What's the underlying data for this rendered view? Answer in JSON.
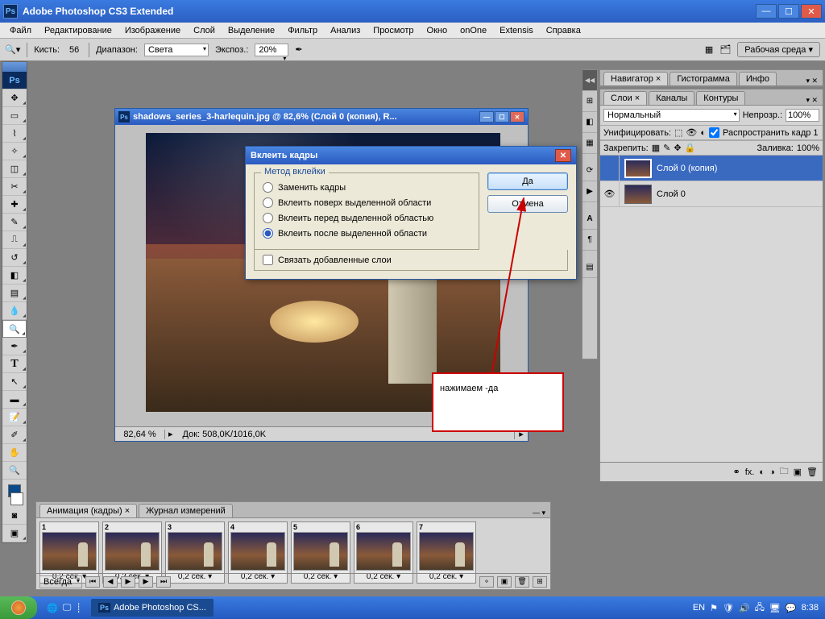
{
  "titlebar": {
    "ps": "Ps",
    "title": "Adobe Photoshop CS3 Extended"
  },
  "menubar": [
    "Файл",
    "Редактирование",
    "Изображение",
    "Слой",
    "Выделение",
    "Фильтр",
    "Анализ",
    "Просмотр",
    "Окно",
    "onOne",
    "Extensis",
    "Справка"
  ],
  "optbar": {
    "brush_label": "Кисть:",
    "brush_size": "56",
    "range_label": "Диапазон:",
    "range_value": "Света",
    "expoz_label": "Экспоз.:",
    "expoz_value": "20%",
    "workspace": "Рабочая среда"
  },
  "doc": {
    "title": "shadows_series_3-harlequin.jpg @ 82,6% (Слой 0 (копия), R...",
    "zoom": "82,64 %",
    "info": "Док: 508,0K/1016,0K"
  },
  "dialog": {
    "title": "Вклеить кадры",
    "legend": "Метод вклейки",
    "opt1": "Заменить кадры",
    "opt2": "Вклеить поверх выделенной области",
    "opt3": "Вклеить перед выделенной областью",
    "opt4": "Вклеить после выделенной области",
    "link": "Связать добавленные слои",
    "yes": "Да",
    "cancel": "Отмена"
  },
  "annotation": {
    "text": "нажимаем -да"
  },
  "navpanel": {
    "tab1": "Навигатор",
    "tab2": "Гистограмма",
    "tab3": "Инфо"
  },
  "layerspanel": {
    "tab1": "Слои",
    "tab2": "Каналы",
    "tab3": "Контуры",
    "mode": "Нормальный",
    "opacity_label": "Непрозр.:",
    "opacity": "100%",
    "unify_label": "Унифицировать:",
    "propagate": "Распространить кадр 1",
    "lock_label": "Закрепить:",
    "fill_label": "Заливка:",
    "fill": "100%",
    "layer1": "Слой 0 (копия)",
    "layer2": "Слой 0"
  },
  "anim": {
    "tab1": "Анимация (кадры)",
    "tab2": "Журнал измерений",
    "frames": [
      {
        "n": "1",
        "d": "0,2 сек."
      },
      {
        "n": "2",
        "d": "0,2 сек."
      },
      {
        "n": "3",
        "d": "0,2 сек."
      },
      {
        "n": "4",
        "d": "0,2 сек."
      },
      {
        "n": "5",
        "d": "0,2 сек."
      },
      {
        "n": "6",
        "d": "0,2 сек."
      },
      {
        "n": "7",
        "d": "0,2 сек."
      }
    ],
    "loop": "Всегда"
  },
  "taskbar": {
    "app": "Adobe Photoshop CS...",
    "lang": "EN",
    "time": "8:38"
  }
}
